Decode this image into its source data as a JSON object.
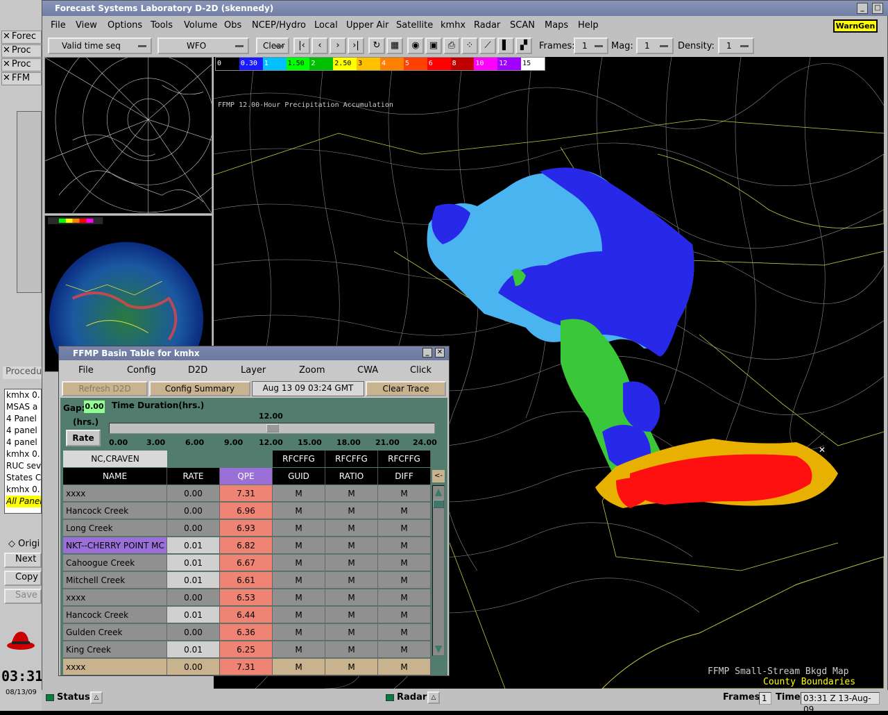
{
  "window": {
    "title": "Forecast Systems Laboratory D-2D (skennedy)"
  },
  "menubar": [
    "File",
    "View",
    "Options",
    "Tools",
    "Volume",
    "Obs",
    "NCEP/Hydro",
    "Local",
    "Upper Air",
    "Satellite",
    "kmhx",
    "Radar",
    "SCAN",
    "Maps",
    "Help"
  ],
  "warngen_label": "WarnGen",
  "toolbar": {
    "time_mode": "Valid time seq",
    "scale": "WFO",
    "clear_label": "Clear",
    "frames_label": "Frames:",
    "frames_value": "1",
    "mag_label": "Mag:",
    "mag_value": "1",
    "density_label": "Density:",
    "density_value": "1"
  },
  "colorbar": {
    "labels": [
      "0",
      "0.30",
      "1",
      "1.50",
      "2",
      "2.50",
      "3",
      "4",
      "5",
      "6",
      "8",
      "10",
      "12",
      "15"
    ],
    "colors": [
      "#000000",
      "#1a1aff",
      "#00c0ff",
      "#00ff00",
      "#00c000",
      "#ffff00",
      "#ffc000",
      "#ff8000",
      "#ff4000",
      "#ff0000",
      "#c00000",
      "#ff00ff",
      "#a000ff",
      "#ffffff"
    ]
  },
  "map": {
    "product_title": "FFMP 12.00-Hour Precipitation Accumulation",
    "legend1": "FFMP Small-Stream Bkgd Map",
    "legend2": "County Boundaries"
  },
  "left": {
    "windows": [
      "Forec",
      "Proc",
      "Proc",
      "FFM"
    ],
    "list": [
      "kmhx 0.",
      "MSAS a",
      "4 Panel",
      "4 panel",
      "4 panel",
      "kmhx 0.",
      "RUC sev",
      "States C",
      "kmhx 0.",
      "All Panel"
    ],
    "procedure_label": "Procedu",
    "orig_label": "Origi",
    "next_label": "Next",
    "copy_label": "Copy",
    "save_label": "Save",
    "clock": "03:31",
    "date": "08/13/09"
  },
  "status": {
    "status_label": "Status:",
    "radar_label": "Radar:",
    "frames_label": "Frames:",
    "frames_value": "1",
    "time_label": "Time:",
    "time_value": "03:31 Z 13-Aug-09"
  },
  "ffmp": {
    "title": "FFMP Basin Table for kmhx",
    "menu": [
      "File",
      "Config",
      "D2D",
      "Layer",
      "Zoom",
      "CWA",
      "Click"
    ],
    "refresh_label": "Refresh D2D",
    "config_summary_label": "Config Summary",
    "datetime": "Aug 13 09 03:24 GMT",
    "clear_trace_label": "Clear Trace",
    "gap_label": "Gap:",
    "gap_value": "0.00",
    "hrs_label": "(hrs.)",
    "rate_button": "Rate",
    "duration_label": "Time Duration(hrs.)",
    "duration_value": "12.00",
    "duration_fraction": 0.5,
    "ticks": [
      "0.00",
      "3.00",
      "6.00",
      "9.00",
      "12.00",
      "15.00",
      "18.00",
      "21.00",
      "24.00"
    ],
    "county": "NC,CRAVEN",
    "group_headers": [
      "RFCFFG",
      "RFCFFG",
      "RFCFFG"
    ],
    "columns": [
      "NAME",
      "RATE",
      "QPE",
      "GUID",
      "RATIO",
      "DIFF"
    ],
    "back_label": "<-",
    "rows": [
      {
        "name": "xxxx",
        "rate": "0.00",
        "qpe": "7.31",
        "guid": "M",
        "ratio": "M",
        "diff": "M"
      },
      {
        "name": "Hancock Creek",
        "rate": "0.00",
        "qpe": "6.96",
        "guid": "M",
        "ratio": "M",
        "diff": "M"
      },
      {
        "name": "Long Creek",
        "rate": "0.00",
        "qpe": "6.93",
        "guid": "M",
        "ratio": "M",
        "diff": "M"
      },
      {
        "name": "NKT--CHERRY POINT MC",
        "rate": "0.01",
        "qpe": "6.82",
        "guid": "M",
        "ratio": "M",
        "diff": "M"
      },
      {
        "name": "Cahoogue Creek",
        "rate": "0.01",
        "qpe": "6.67",
        "guid": "M",
        "ratio": "M",
        "diff": "M"
      },
      {
        "name": "Mitchell Creek",
        "rate": "0.01",
        "qpe": "6.61",
        "guid": "M",
        "ratio": "M",
        "diff": "M"
      },
      {
        "name": "xxxx",
        "rate": "0.00",
        "qpe": "6.53",
        "guid": "M",
        "ratio": "M",
        "diff": "M"
      },
      {
        "name": "Hancock Creek",
        "rate": "0.01",
        "qpe": "6.44",
        "guid": "M",
        "ratio": "M",
        "diff": "M"
      },
      {
        "name": "Gulden Creek",
        "rate": "0.00",
        "qpe": "6.36",
        "guid": "M",
        "ratio": "M",
        "diff": "M"
      },
      {
        "name": "King Creek",
        "rate": "0.01",
        "qpe": "6.25",
        "guid": "M",
        "ratio": "M",
        "diff": "M"
      }
    ],
    "total_row": {
      "name": "xxxx",
      "rate": "0.00",
      "qpe": "7.31",
      "guid": "M",
      "ratio": "M",
      "diff": "M"
    }
  }
}
